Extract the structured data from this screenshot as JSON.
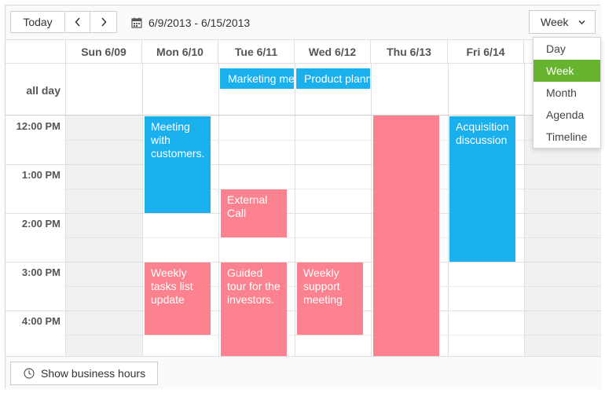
{
  "toolbar": {
    "today_label": "Today",
    "prev_icon": "chevron-left-icon",
    "next_icon": "chevron-right-icon",
    "date_range": "6/9/2013 - 6/15/2013",
    "view_selected": "Week"
  },
  "view_menu": {
    "items": [
      {
        "label": "Day"
      },
      {
        "label": "Week",
        "selected": true
      },
      {
        "label": "Month"
      },
      {
        "label": "Agenda"
      },
      {
        "label": "Timeline"
      }
    ]
  },
  "days": [
    "Sun 6/09",
    "Mon 6/10",
    "Tue 6/11",
    "Wed 6/12",
    "Thu 6/13",
    "Fri 6/14"
  ],
  "allday_label": "all day",
  "times": [
    "12:00 PM",
    "1:00 PM",
    "2:00 PM",
    "3:00 PM",
    "4:00 PM"
  ],
  "allday_events": {
    "marketing": "Marketing meeting",
    "product": "Product planning"
  },
  "events": {
    "meeting_customers": "Meeting with customers.",
    "external_call": "External Call",
    "acquisition": "Acquisition discussion",
    "weekly_tasks": "Weekly tasks list update",
    "guided_tour": "Guided tour for the investors.",
    "weekly_support": "Weekly support meeting",
    "thu_event": ""
  },
  "colors": {
    "event_blue": "#1ab0ee",
    "event_pink": "#fd828f",
    "selected_green": "#65b32e"
  },
  "footer": {
    "business_hours_label": "Show business hours",
    "icon": "clock-icon"
  }
}
